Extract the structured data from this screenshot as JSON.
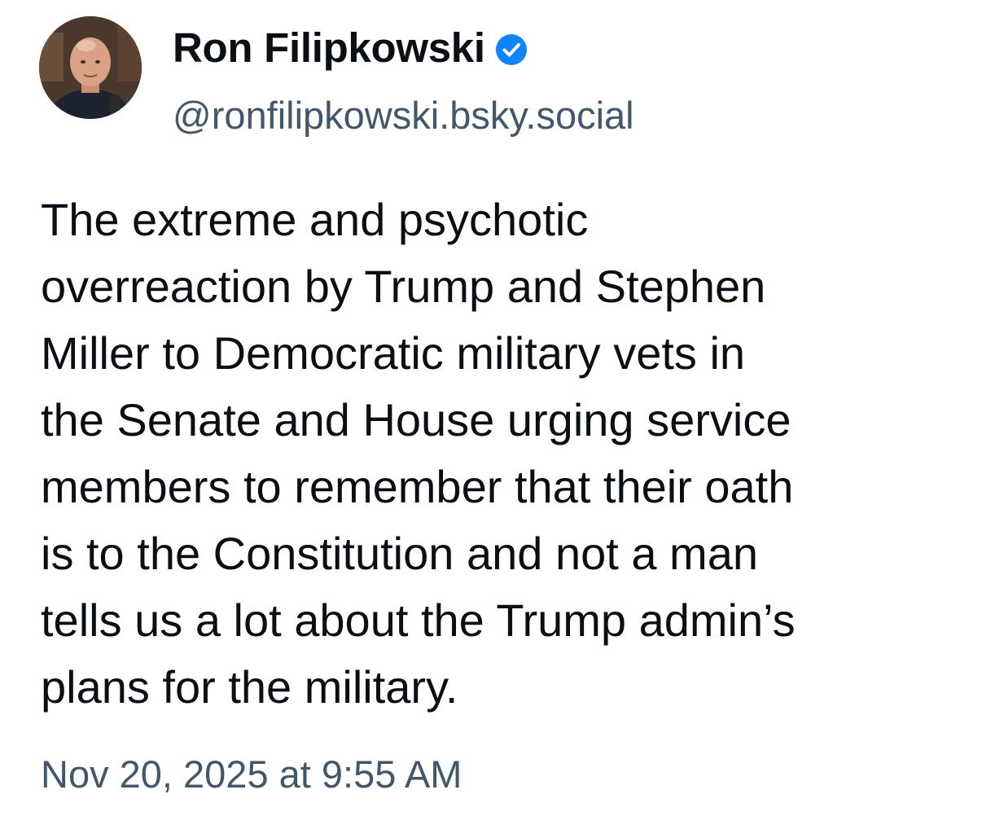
{
  "author": {
    "display_name": "Ron Filipkowski",
    "handle": "@ronfilipkowski.bsky.social",
    "verified": true,
    "verified_badge_color": "#1083fe"
  },
  "post": {
    "text_lines": [
      "The extreme and psychotic",
      "overreaction by Trump and Stephen",
      "Miller to Democratic military vets in",
      "the Senate and House urging service",
      "members to remember that their oath",
      "is to the Constitution and not a man",
      "tells us a lot about the Trump admin’s",
      "plans for the military."
    ],
    "timestamp": "Nov 20, 2025 at 9:55 AM"
  },
  "colors": {
    "text": "#0b0f14",
    "secondary_text": "#42576c",
    "background": "#ffffff"
  }
}
